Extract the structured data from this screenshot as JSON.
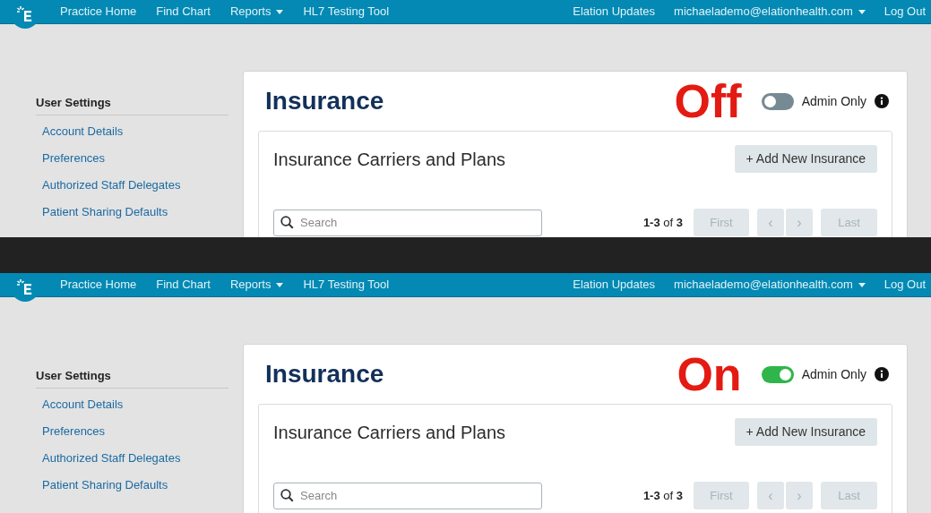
{
  "panels": [
    {
      "nav": {
        "items": [
          {
            "label": "Practice Home",
            "dropdown": false
          },
          {
            "label": "Find Chart",
            "dropdown": false
          },
          {
            "label": "Reports",
            "dropdown": true
          },
          {
            "label": "HL7 Testing Tool",
            "dropdown": false
          }
        ],
        "right": [
          {
            "label": "Elation Updates",
            "dropdown": false
          },
          {
            "label": "michaelademo@elationhealth.com",
            "dropdown": true
          },
          {
            "label": "Log Out",
            "dropdown": false
          }
        ]
      },
      "sidebar": {
        "heading": "User Settings",
        "links": [
          "Account Details",
          "Preferences",
          "Authorized Staff Delegates",
          "Patient Sharing Defaults"
        ]
      },
      "title": "Insurance",
      "annotation": "Off",
      "toggle": {
        "label": "Admin Only",
        "on": false
      },
      "section": {
        "title": "Insurance Carriers and Plans",
        "add_button": "+ Add New Insurance",
        "search": {
          "placeholder": "Search"
        },
        "pagination": {
          "range": "1-3",
          "of": "of",
          "total": "3",
          "buttons": [
            "First",
            "‹",
            "›",
            "Last"
          ]
        }
      }
    },
    {
      "nav": {
        "items": [
          {
            "label": "Practice Home",
            "dropdown": false
          },
          {
            "label": "Find Chart",
            "dropdown": false
          },
          {
            "label": "Reports",
            "dropdown": true
          },
          {
            "label": "HL7 Testing Tool",
            "dropdown": false
          }
        ],
        "right": [
          {
            "label": "Elation Updates",
            "dropdown": false
          },
          {
            "label": "michaelademo@elationhealth.com",
            "dropdown": true
          },
          {
            "label": "Log Out",
            "dropdown": false
          }
        ]
      },
      "sidebar": {
        "heading": "User Settings",
        "links": [
          "Account Details",
          "Preferences",
          "Authorized Staff Delegates",
          "Patient Sharing Defaults"
        ]
      },
      "title": "Insurance",
      "annotation": "On",
      "toggle": {
        "label": "Admin Only",
        "on": true
      },
      "section": {
        "title": "Insurance Carriers and Plans",
        "add_button": "+ Add New Insurance",
        "search": {
          "placeholder": "Search"
        },
        "pagination": {
          "range": "1-3",
          "of": "of",
          "total": "3",
          "buttons": [
            "First",
            "‹",
            "›",
            "Last"
          ]
        }
      }
    }
  ]
}
